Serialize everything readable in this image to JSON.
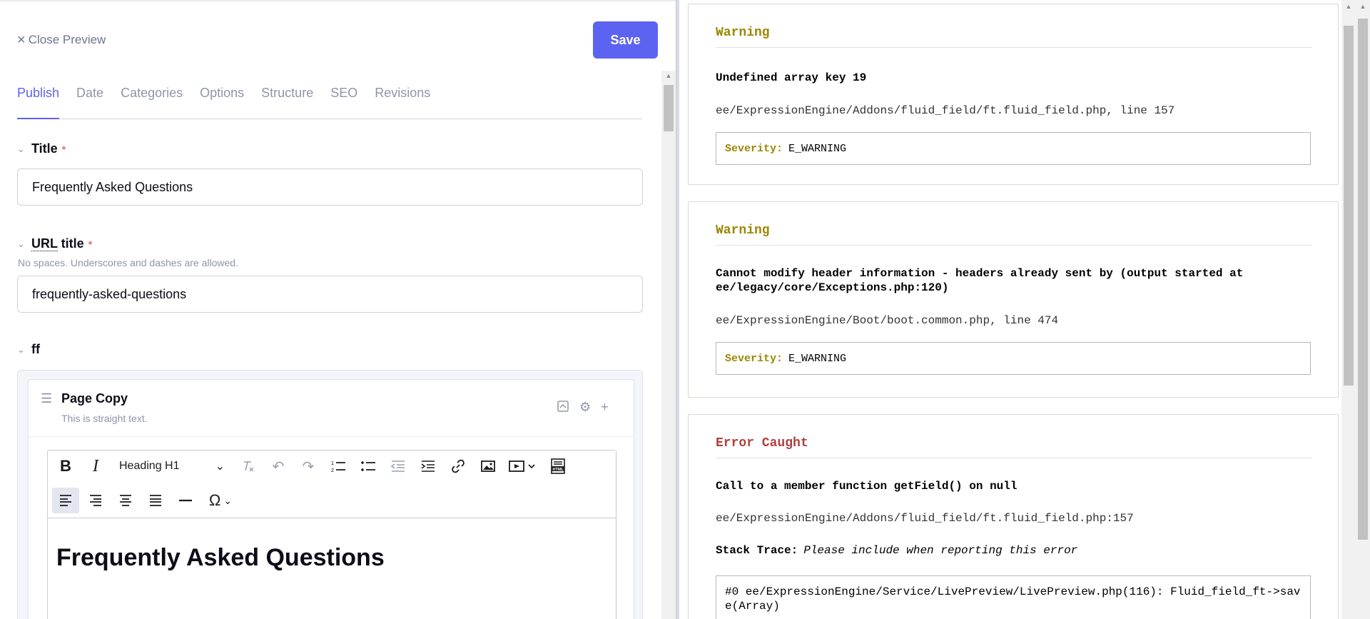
{
  "header": {
    "close_preview": "Close Preview",
    "save_label": "Save"
  },
  "tabs": [
    {
      "label": "Publish",
      "active": true
    },
    {
      "label": "Date",
      "active": false
    },
    {
      "label": "Categories",
      "active": false
    },
    {
      "label": "Options",
      "active": false
    },
    {
      "label": "Structure",
      "active": false
    },
    {
      "label": "SEO",
      "active": false
    },
    {
      "label": "Revisions",
      "active": false
    }
  ],
  "fields": {
    "title": {
      "label": "Title",
      "required_mark": "*",
      "value": "Frequently Asked Questions"
    },
    "url_title": {
      "label_abbr": "URL",
      "label_rest": " title",
      "required_mark": "*",
      "hint": "No spaces. Underscores and dashes are allowed.",
      "value": "frequently-asked-questions"
    },
    "ff": {
      "label": "ff"
    }
  },
  "fluid_item": {
    "title": "Page Copy",
    "subtitle": "This is straight text."
  },
  "editor": {
    "heading_select": "Heading H1",
    "content_heading": "Frequently Asked Questions"
  },
  "errors": [
    {
      "title": "Warning",
      "message": "Undefined array key 19",
      "file": "ee/ExpressionEngine/Addons/fluid_field/ft.fluid_field.php, line 157",
      "severity_label": "Severity:",
      "severity": "E_WARNING"
    },
    {
      "title": "Warning",
      "message": "Cannot modify header information - headers already sent by (output started at ee/legacy/core/Exceptions.php:120)",
      "file": "ee/ExpressionEngine/Boot/boot.common.php, line 474",
      "severity_label": "Severity:",
      "severity": "E_WARNING"
    },
    {
      "title": "Error Caught",
      "message": "Call to a member function getField() on null",
      "file": "ee/ExpressionEngine/Addons/fluid_field/ft.fluid_field.php:157",
      "stack_label": "Stack Trace:",
      "stack_note": "Please include when reporting this error",
      "trace": "#0 ee/ExpressionEngine/Service/LivePreview/LivePreview.php(116): Fluid_field_ft->save(Array)"
    }
  ],
  "colors": {
    "accent": "#5d63f1",
    "warning_title": "#9b8700",
    "error_title": "#b13f3f",
    "required": "#e06c6c"
  }
}
